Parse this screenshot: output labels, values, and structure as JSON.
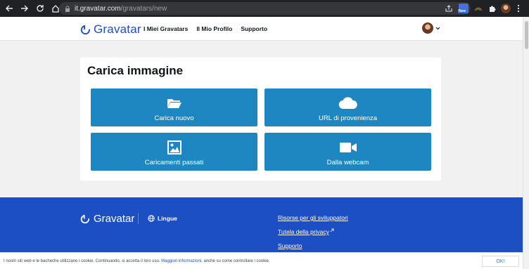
{
  "browser": {
    "url_host": "it.gravatar.com",
    "url_path": "/gravatars/new",
    "new_badge": "New"
  },
  "header": {
    "logo_text": "Gravatar",
    "nav": [
      "I Miei Gravatars",
      "Il Mio Profilo",
      "Supporto"
    ]
  },
  "main": {
    "title": "Carica immagine",
    "tiles": [
      {
        "label": "Carica nuovo",
        "icon": "folder-open-icon"
      },
      {
        "label": "URL di provenienza",
        "icon": "cloud-icon"
      },
      {
        "label": "Caricamenti passati",
        "icon": "image-icon"
      },
      {
        "label": "Dalla webcam",
        "icon": "video-camera-icon"
      }
    ]
  },
  "footer": {
    "logo_text": "Gravatar",
    "language_label": "Lingue",
    "links": [
      "Risorse per gli sviluppatori",
      "Tutela della privacy",
      "Supporto"
    ]
  },
  "cookie": {
    "text_before": "I nostri siti web e le bacheche utilizzano i cookie. Continuando, si accetta il loro uso. ",
    "link": "Maggiori informazioni",
    "text_after": ", anche su come controllare i cookie.",
    "ok_label": "OK!"
  },
  "colors": {
    "brand_blue": "#1d4fc4",
    "tile_blue": "#1e87c2"
  }
}
